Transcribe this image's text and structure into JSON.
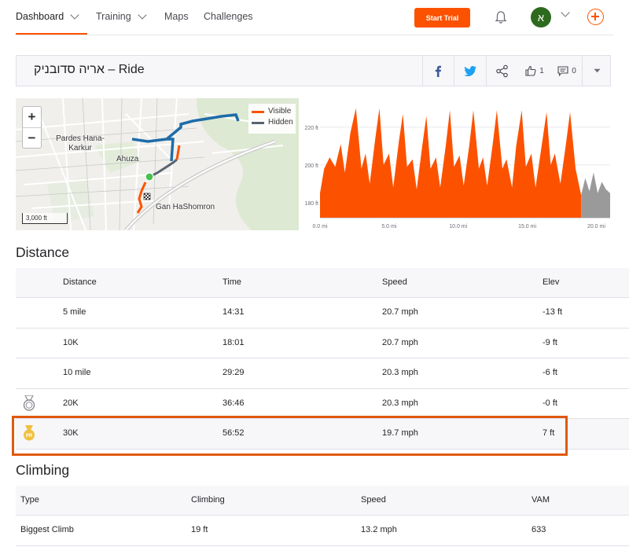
{
  "nav": {
    "items": [
      {
        "label": "Dashboard",
        "has_menu": true
      },
      {
        "label": "Training",
        "has_menu": true
      },
      {
        "label": "Maps",
        "has_menu": false
      },
      {
        "label": "Challenges",
        "has_menu": false
      }
    ],
    "start_trial_label": "Start Trial",
    "avatar_initial": "א",
    "accent": "#fc5200"
  },
  "activity": {
    "title": "אריה סדובניק – Ride",
    "kudos_count": "1",
    "comment_count": "0"
  },
  "map": {
    "legend": {
      "visible_label": "Visible",
      "hidden_label": "Hidden",
      "visible_color": "#fc5200",
      "hidden_color": "#5a6470"
    },
    "places": [
      "Pardes Hana-Karkur",
      "Ahuza",
      "Gan HaShomron"
    ],
    "scale_label": "3,000 ft",
    "zoom_in": "+",
    "zoom_out": "−"
  },
  "chart_data": {
    "type": "area",
    "y_ticks": [
      "220 ft",
      "200 ft",
      "180 ft"
    ],
    "x_ticks": [
      "0.0 mi",
      "5.0 mi",
      "10.0 mi",
      "15.0 mi",
      "20.0 mi"
    ],
    "ylim": [
      172,
      232
    ],
    "xlim": [
      0,
      21
    ],
    "series": [
      {
        "color": "#fc5200",
        "x": [
          0,
          0.3,
          0.7,
          1.1,
          1.5,
          1.8,
          2.2,
          2.6,
          3,
          3.3,
          3.6,
          4,
          4.3,
          4.6,
          5,
          5.3,
          5.7,
          6,
          6.3,
          6.7,
          7,
          7.4,
          7.7,
          8,
          8.4,
          8.7,
          9.1,
          9.4,
          9.7,
          10.1,
          10.4,
          10.8,
          11.1,
          11.5,
          11.8,
          12.1,
          12.5,
          12.8,
          13.2,
          13.5,
          13.9,
          14.2,
          14.6,
          14.9,
          15.3,
          15.6,
          16,
          16.4,
          16.7,
          17,
          17.4,
          17.8,
          18.1,
          18.5,
          18.9
        ],
        "y": [
          185,
          198,
          204,
          199,
          211,
          196,
          217,
          230,
          198,
          206,
          190,
          214,
          230,
          200,
          206,
          188,
          212,
          227,
          199,
          203,
          187,
          210,
          226,
          198,
          204,
          188,
          210,
          229,
          199,
          205,
          189,
          210,
          229,
          198,
          204,
          189,
          211,
          229,
          198,
          203,
          188,
          210,
          229,
          199,
          206,
          188,
          208,
          228,
          200,
          206,
          190,
          211,
          228,
          198,
          184
        ]
      },
      {
        "color": "#9a9a9a",
        "x": [
          18.9,
          19.2,
          19.5,
          19.8,
          20.1,
          20.4,
          20.7,
          21
        ],
        "y": [
          184,
          193,
          186,
          196,
          185,
          191,
          187,
          185
        ]
      }
    ]
  },
  "distance": {
    "title": "Distance",
    "headers": [
      "Distance",
      "Time",
      "Speed",
      "Elev"
    ],
    "rows": [
      {
        "distance": "5 mile",
        "time": "14:31",
        "speed": "20.7 mph",
        "elev": "-13 ft",
        "medal": ""
      },
      {
        "distance": "10K",
        "time": "18:01",
        "speed": "20.7 mph",
        "elev": "-9 ft",
        "medal": ""
      },
      {
        "distance": "10 mile",
        "time": "29:29",
        "speed": "20.3 mph",
        "elev": "-6 ft",
        "medal": ""
      },
      {
        "distance": "20K",
        "time": "36:46",
        "speed": "20.3 mph",
        "elev": "-0 ft",
        "medal": "silver-medal"
      },
      {
        "distance": "30K",
        "time": "56:52",
        "speed": "19.7 mph",
        "elev": "7 ft",
        "medal": "gold-pr-medal"
      }
    ],
    "medal_pr_label": "PR"
  },
  "climbing": {
    "title": "Climbing",
    "headers": [
      "Type",
      "Climbing",
      "Speed",
      "VAM"
    ],
    "rows": [
      {
        "type": "Biggest Climb",
        "climbing": "19 ft",
        "speed": "13.2 mph",
        "vam": "633"
      }
    ]
  }
}
